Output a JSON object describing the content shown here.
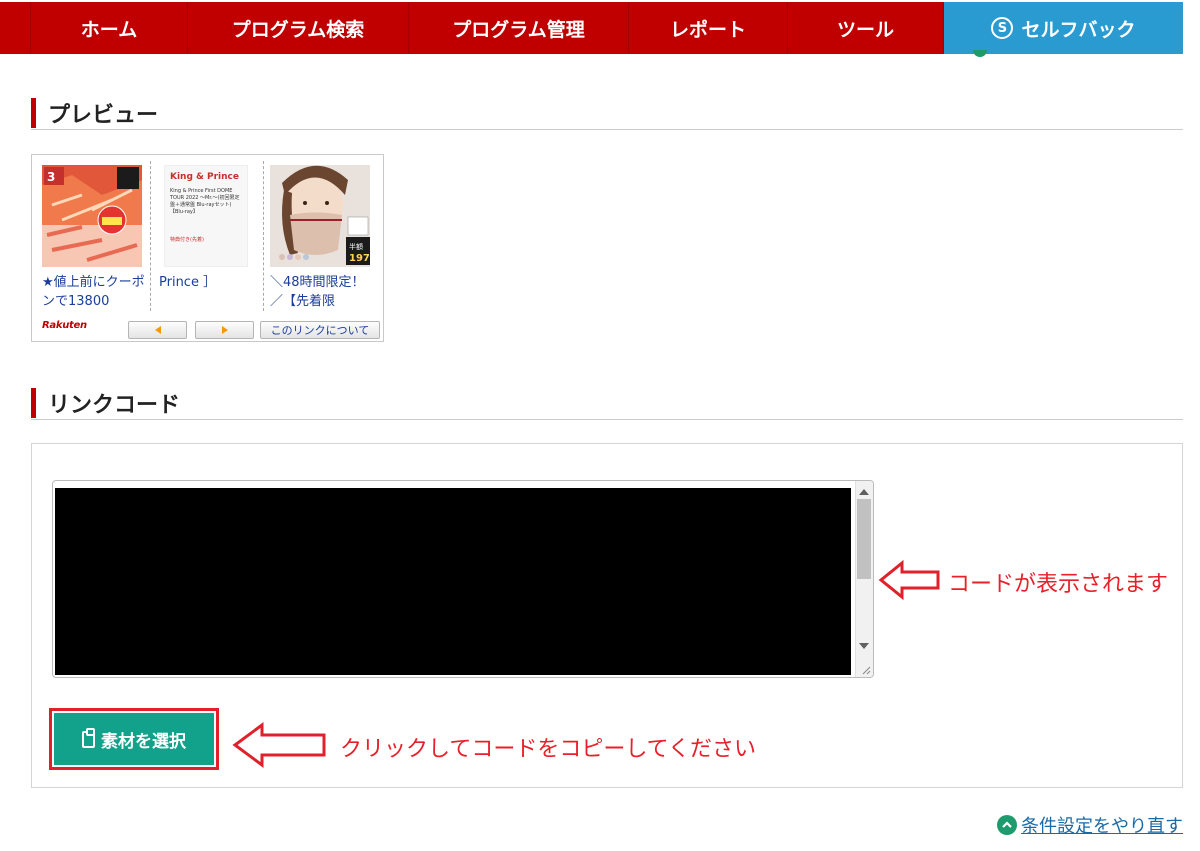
{
  "nav": {
    "items": [
      {
        "label": "ホーム"
      },
      {
        "label": "プログラム検索"
      },
      {
        "label": "プログラム管理"
      },
      {
        "label": "レポート"
      },
      {
        "label": "ツール"
      },
      {
        "label": "セルフバック",
        "active": true
      }
    ]
  },
  "preview": {
    "heading": "プレビュー",
    "items": [
      {
        "text": "★値上前にクーポンで13800",
        "image": "crab-product-image"
      },
      {
        "text": "Prince ］",
        "image": "king-and-prince-dvd-image",
        "card_title": "King & Prince",
        "card_body": "King & Prince First DOME TOUR 2022 〜Mr.〜(初回限定盤＋通常盤 Blu-rayセット)【Blu-ray】",
        "card_note": "特典付き(先着)"
      },
      {
        "text": "＼48時間限定！／【先着限",
        "image": "face-mask-product-image"
      }
    ],
    "logo": "Rakuten",
    "about_label": "このリンクについて"
  },
  "link_code": {
    "heading": "リンクコード",
    "annotation": "コードが表示されます"
  },
  "select_button": {
    "label": "素材を選択",
    "annotation": "クリックしてコードをコピーしてください"
  },
  "reset_link": {
    "label": "条件設定をやり直す"
  },
  "colors": {
    "nav_red": "#c00000",
    "nav_active": "#2a9bd0",
    "button_green": "#12a18a",
    "annotation_red": "#e8202a",
    "link_blue": "#1a6aa6"
  }
}
